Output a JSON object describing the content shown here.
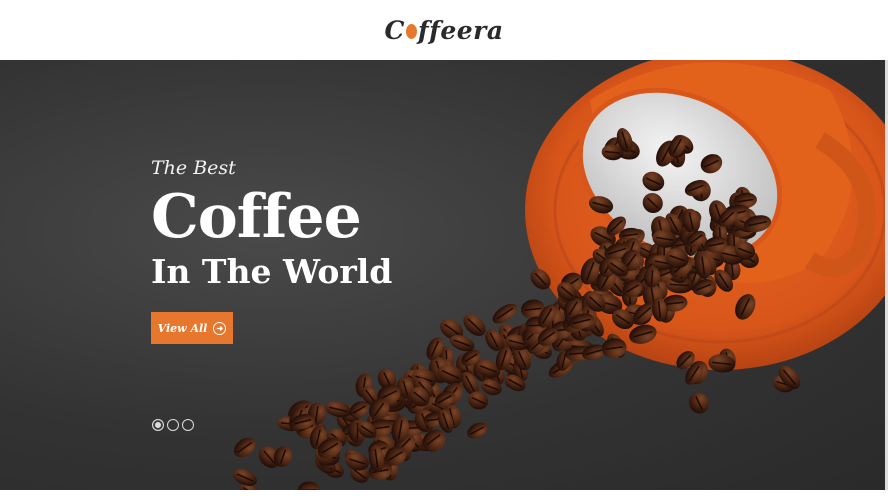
{
  "header": {
    "logo_prefix": "C",
    "logo_suffix": "ffeera"
  },
  "hero": {
    "tagline": "The Best",
    "headline": "Coffee",
    "subheadline": "In The World",
    "cta_label": "View All",
    "cta_icon": "arrow-right-circle-icon",
    "slides": [
      {
        "active": true
      },
      {
        "active": false
      },
      {
        "active": false
      }
    ]
  },
  "colors": {
    "accent": "#e8772e",
    "hero_background": "#3b3b3b",
    "header_background": "#ffffff"
  }
}
